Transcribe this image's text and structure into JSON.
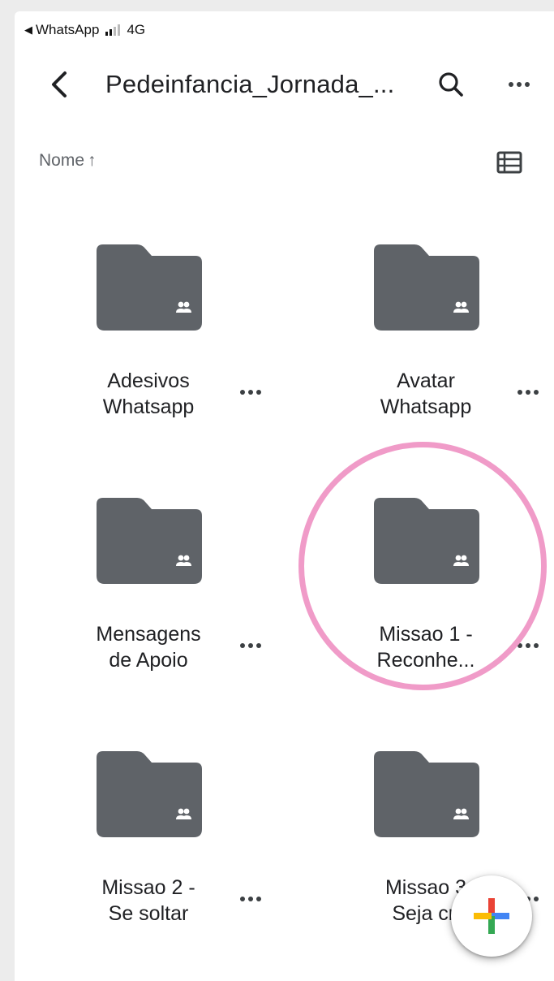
{
  "status_bar": {
    "back_app": "WhatsApp",
    "network": "4G"
  },
  "toolbar": {
    "title": "Pedeinfancia_Jornada_...",
    "back_icon": "chevron-left-icon",
    "search_icon": "search-icon",
    "more_icon": "more-horizontal-icon"
  },
  "sort": {
    "label": "Nome",
    "arrow": "↑",
    "view_icon": "list-view-icon"
  },
  "folders": [
    {
      "line1": "Adesivos",
      "line2": "Whatsapp",
      "icon": "shared-folder-icon"
    },
    {
      "line1": "Avatar",
      "line2": "Whatsapp",
      "icon": "shared-folder-icon"
    },
    {
      "line1": "Mensagens",
      "line2": "de Apoio",
      "icon": "shared-folder-icon"
    },
    {
      "line1": "Missao 1 -",
      "line2": "Reconhe...",
      "icon": "shared-folder-icon",
      "highlighted": true
    },
    {
      "line1": "Missao 2 -",
      "line2": "Se soltar",
      "icon": "shared-folder-icon"
    },
    {
      "line1": "Missao 3",
      "line2": "Seja cri",
      "icon": "shared-folder-icon"
    }
  ],
  "fab": {
    "icon": "plus-icon"
  },
  "colors": {
    "folder": "#5f6368",
    "highlight": "#f09bc8",
    "plus_red": "#ea4335",
    "plus_blue": "#4285f4",
    "plus_yellow": "#fbbc04",
    "plus_green": "#34a853"
  }
}
